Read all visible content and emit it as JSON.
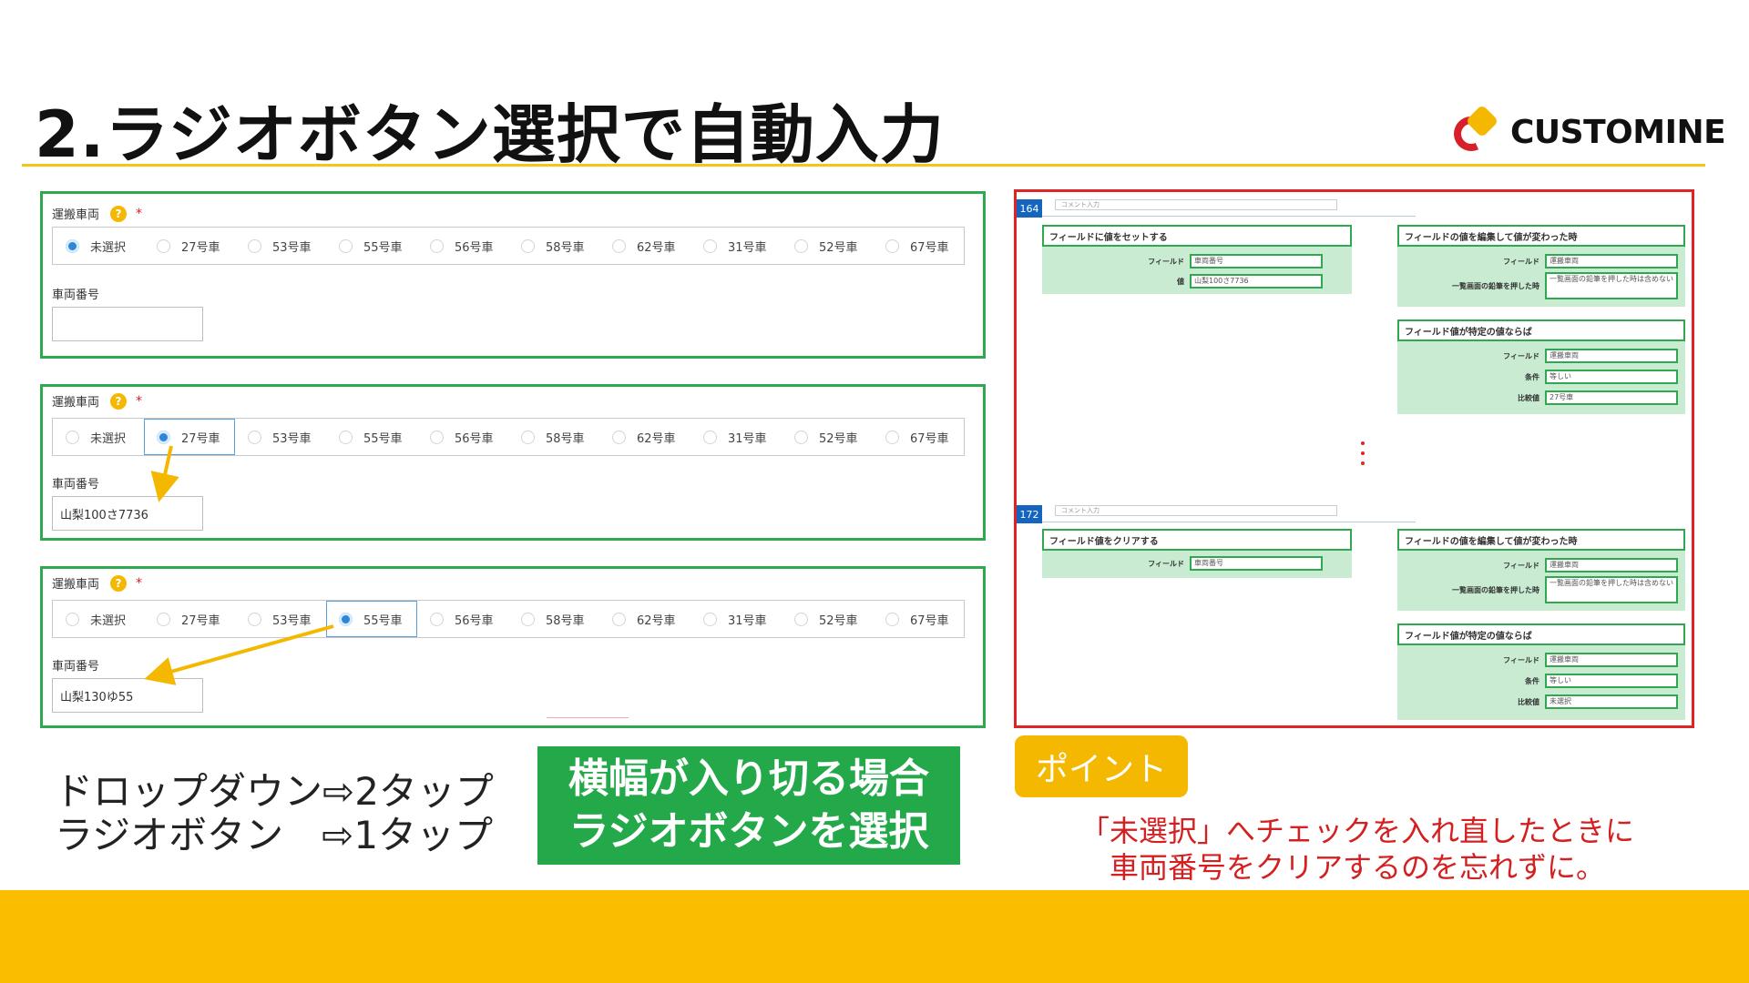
{
  "slide": {
    "title": "2.ラジオボタン選択で自動入力",
    "logo_text": "CUSTOMINE",
    "colors": {
      "accent_yellow": "#fbbd00",
      "panel_green": "#2fa84f",
      "config_red": "#e02424",
      "radio_blue": "#2d86d6"
    }
  },
  "form": {
    "field_label": "運搬車両",
    "help_icon": "?",
    "required_mark": "*",
    "text_field_label": "車両番号",
    "radio_options": [
      "未選択",
      "27号車",
      "53号車",
      "55号車",
      "56号車",
      "58号車",
      "62号車",
      "31号車",
      "52号車",
      "67号車"
    ]
  },
  "panels": [
    {
      "selected": "未選択",
      "vehicle_number": ""
    },
    {
      "selected": "27号車",
      "vehicle_number": "山梨100さ7736"
    },
    {
      "selected": "55号車",
      "vehicle_number": "山梨130ゆ55"
    }
  ],
  "comparison": {
    "line1": "ドロップダウン⇨2タップ",
    "line2": "ラジオボタン　⇨1タップ"
  },
  "callout": {
    "line1": "横幅が入り切る場合",
    "line2": "ラジオボタンを選択"
  },
  "config": {
    "comment_placeholder": "コメント入力",
    "rule1": {
      "number": "164",
      "action": {
        "title": "フィールドに値をセットする",
        "field_key": "フィールド",
        "field_val": "車両番号",
        "value_key": "値",
        "value_val": "山梨100さ7736"
      },
      "trigger": {
        "title": "フィールドの値を編集して値が変わった時",
        "field_key": "フィールド",
        "field_val": "運搬車両",
        "opt_key": "一覧画面の鉛筆を押した時",
        "opt_val": "一覧画面の鉛筆を押した時は含めない"
      },
      "condition": {
        "title": "フィールド値が特定の値ならば",
        "field_key": "フィールド",
        "field_val": "運搬車両",
        "cond_key": "条件",
        "cond_val": "等しい",
        "cmp_key": "比較値",
        "cmp_val": "27号車"
      }
    },
    "rule2": {
      "number": "172",
      "action": {
        "title": "フィールド値をクリアする",
        "field_key": "フィールド",
        "field_val": "車両番号"
      },
      "trigger": {
        "title": "フィールドの値を編集して値が変わった時",
        "field_key": "フィールド",
        "field_val": "運搬車両",
        "opt_key": "一覧画面の鉛筆を押した時",
        "opt_val": "一覧画面の鉛筆を押した時は含めない"
      },
      "condition": {
        "title": "フィールド値が特定の値ならば",
        "field_key": "フィールド",
        "field_val": "運搬車両",
        "cond_key": "条件",
        "cond_val": "等しい",
        "cmp_key": "比較値",
        "cmp_val": "未選択"
      }
    }
  },
  "point": {
    "badge": "ポイント",
    "note_line1": "「未選択」へチェックを入れ直したときに",
    "note_line2": "車両番号をクリアするのを忘れずに。"
  }
}
